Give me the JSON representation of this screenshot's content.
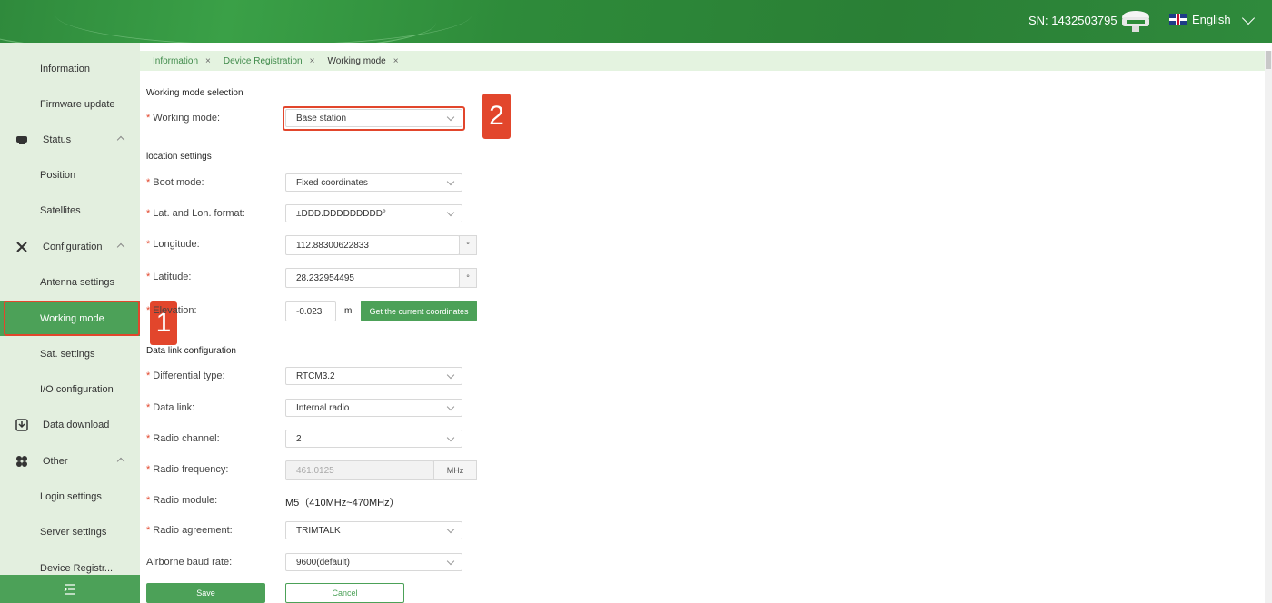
{
  "header": {
    "sn_label": "SN:",
    "sn_value": "1432503795",
    "language": "English"
  },
  "sidebar": {
    "items": [
      {
        "label": "Information"
      },
      {
        "label": "Firmware update"
      },
      {
        "label": "Status"
      },
      {
        "label": "Position"
      },
      {
        "label": "Satellites"
      },
      {
        "label": "Configuration"
      },
      {
        "label": "Antenna settings"
      },
      {
        "label": "Working mode"
      },
      {
        "label": "Sat. settings"
      },
      {
        "label": "I/O configuration"
      },
      {
        "label": "Data download"
      },
      {
        "label": "Other"
      },
      {
        "label": "Login settings"
      },
      {
        "label": "Server settings"
      },
      {
        "label": "Device Registr..."
      }
    ]
  },
  "tabs": [
    {
      "label": "Information",
      "close": "×"
    },
    {
      "label": "Device Registration",
      "close": "×"
    },
    {
      "label": "Working mode",
      "close": "×"
    }
  ],
  "annotations": {
    "badge1": "1",
    "badge2": "2"
  },
  "form": {
    "section_mode": "Working mode selection",
    "working_mode_label": "Working mode:",
    "working_mode_value": "Base station",
    "section_location": "location settings",
    "boot_mode_label": "Boot mode:",
    "boot_mode_value": "Fixed coordinates",
    "latlon_format_label": "Lat. and Lon. format:",
    "latlon_format_value": "±DDD.DDDDDDDDD°",
    "longitude_label": "Longitude:",
    "longitude_value": "112.88300622833",
    "longitude_unit": "°",
    "latitude_label": "Latitude:",
    "latitude_value": "28.232954495",
    "latitude_unit": "°",
    "elevation_label": "Elevation:",
    "elevation_value": "-0.023",
    "elevation_unit": "m",
    "get_coords_button": "Get the current coordinates",
    "section_datalink": "Data link configuration",
    "diff_type_label": "Differential type:",
    "diff_type_value": "RTCM3.2",
    "data_link_label": "Data link:",
    "data_link_value": "Internal radio",
    "radio_channel_label": "Radio channel:",
    "radio_channel_value": "2",
    "radio_freq_label": "Radio frequency:",
    "radio_freq_value": "461.0125",
    "radio_freq_unit": "MHz",
    "radio_module_label": "Radio module:",
    "radio_module_value": "M5（410MHz~470MHz）",
    "radio_agreement_label": "Radio agreement:",
    "radio_agreement_value": "TRIMTALK",
    "baud_label": "Airborne baud rate:",
    "baud_value": "9600(default)",
    "save_button": "Save",
    "cancel_button": "Cancel"
  },
  "colors": {
    "primary_green": "#4ca158",
    "header_green": "#2e8b3a",
    "sidebar_bg": "#e3efdf",
    "annotation_red": "#e2462c"
  }
}
